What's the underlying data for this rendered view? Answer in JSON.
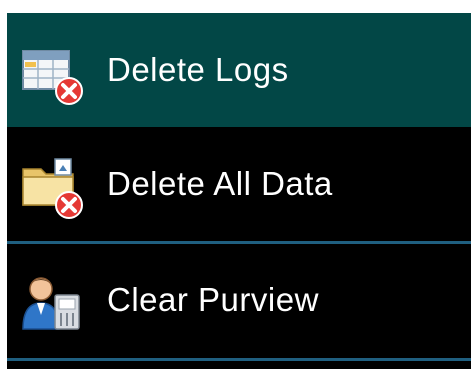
{
  "menu": {
    "items": [
      {
        "label": "Delete Logs",
        "icon": "delete-logs-icon",
        "selected": true
      },
      {
        "label": "Delete All Data",
        "icon": "delete-all-data-icon",
        "selected": false
      },
      {
        "label": "Clear Purview",
        "icon": "clear-purview-icon",
        "selected": false
      }
    ]
  },
  "colors": {
    "background": "#000000",
    "selected_background": "#024746",
    "divider": "#1f5f80",
    "text": "#ffffff",
    "delete_badge": "#e53935"
  }
}
